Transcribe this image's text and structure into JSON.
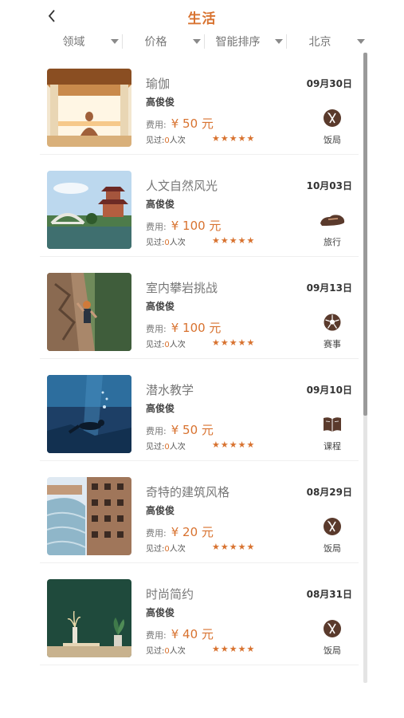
{
  "header": {
    "title": "生活",
    "back_icon": "chevron-left-icon"
  },
  "filters": [
    {
      "label": "领域"
    },
    {
      "label": "价格"
    },
    {
      "label": "智能排序"
    },
    {
      "label": "北京"
    }
  ],
  "colors": {
    "accent": "#d8722f",
    "category_icon": "#5a3a2c"
  },
  "list": {
    "fee_label": "费用:",
    "seen_prefix": "见过:",
    "seen_suffix": "人次",
    "stars": "★★★★★",
    "items": [
      {
        "title": "瑜伽",
        "author": "高俊俊",
        "fee": "¥ 50 元",
        "seen": "0",
        "date": "09月30日",
        "category": "饭局",
        "category_icon": "fork-knife-icon",
        "rating": 5
      },
      {
        "title": "人文自然风光",
        "author": "高俊俊",
        "fee": "¥ 100 元",
        "seen": "0",
        "date": "10月03日",
        "category": "旅行",
        "category_icon": "shoe-icon",
        "rating": 5
      },
      {
        "title": "室内攀岩挑战",
        "author": "高俊俊",
        "fee": "¥ 100 元",
        "seen": "0",
        "date": "09月13日",
        "category": "赛事",
        "category_icon": "soccer-ball-icon",
        "rating": 5
      },
      {
        "title": "潜水教学",
        "author": "高俊俊",
        "fee": "¥ 50 元",
        "seen": "0",
        "date": "09月10日",
        "category": "课程",
        "category_icon": "book-icon",
        "rating": 5
      },
      {
        "title": "奇特的建筑风格",
        "author": "高俊俊",
        "fee": "¥ 20 元",
        "seen": "0",
        "date": "08月29日",
        "category": "饭局",
        "category_icon": "fork-knife-icon",
        "rating": 5
      },
      {
        "title": "时尚简约",
        "author": "高俊俊",
        "fee": "¥ 40 元",
        "seen": "0",
        "date": "08月31日",
        "category": "饭局",
        "category_icon": "fork-knife-icon",
        "rating": 5
      }
    ]
  }
}
